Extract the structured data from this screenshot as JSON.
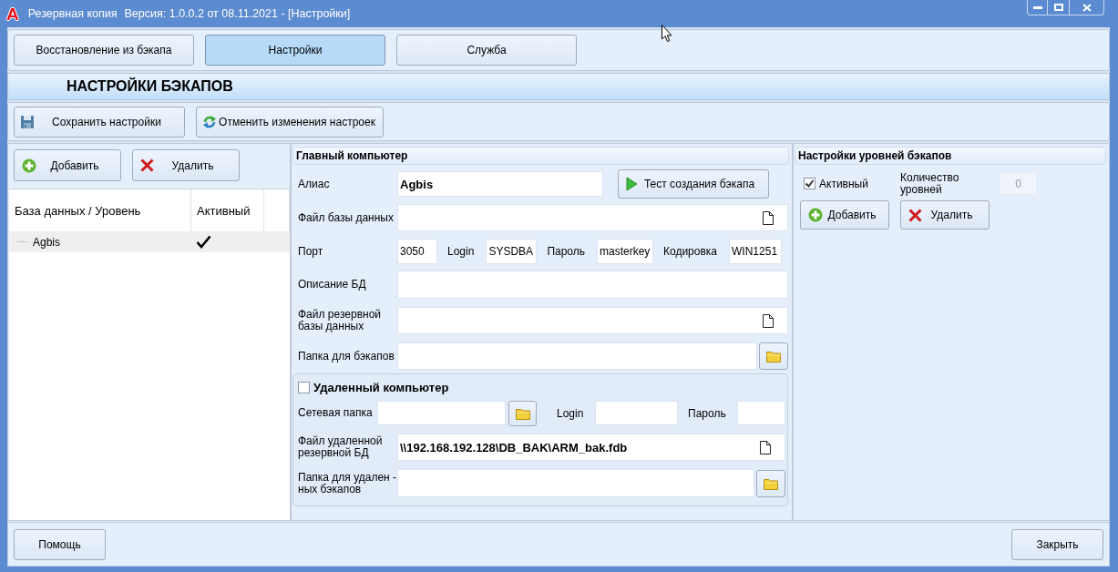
{
  "window": {
    "logo": "A",
    "app_name": "Резервная копия",
    "version": "Версия: 1.0.0.2 от 08.11.2021 - [Настройки]"
  },
  "tabs": [
    {
      "label": "Восстановление из бэкапа",
      "selected": false
    },
    {
      "label": "Настройки",
      "selected": true
    },
    {
      "label": "Служба",
      "selected": false
    }
  ],
  "section_title": "НАСТРОЙКИ БЭКАПОВ",
  "toolbar": [
    {
      "label": "Сохранить настройки",
      "kind": "save"
    },
    {
      "label": "Отменить изменения настроек",
      "kind": "revert"
    }
  ],
  "databases": {
    "buttons": [
      {
        "label": "Добавить",
        "kind": "add"
      },
      {
        "label": "Удалить",
        "kind": "delete"
      }
    ],
    "columns": [
      "База данных / Уровень",
      "Активный"
    ],
    "rows": [
      {
        "name": "Agbis",
        "active": true,
        "selected": true
      }
    ]
  },
  "main_computer": {
    "title": "Главный компьютер",
    "alias": {
      "label": "Алиас",
      "value": "Agbis"
    },
    "test_button": "Тест создания бэкапа",
    "db_file": {
      "label": "Файл базы данных"
    },
    "connection": [
      {
        "label": "Порт",
        "value": "3050"
      },
      {
        "label": "Login",
        "value": "SYSDBA"
      },
      {
        "label": "Пароль",
        "value": "masterkey"
      },
      {
        "label": "Кодировка",
        "value": "WIN1251"
      }
    ],
    "description": {
      "label": "Описание БД"
    },
    "backup_file": {
      "label": "Файл резервной\nбазы данных"
    },
    "backup_folder": {
      "label": "Папка для бэкапов"
    }
  },
  "remote_computer": {
    "title": "Удаленный компьютер",
    "enabled": false,
    "network_folder": {
      "label": "Сетевая папка"
    },
    "login": {
      "label": "Login"
    },
    "password": {
      "label": "Пароль"
    },
    "remote_file": {
      "label": "Файл удаленной\nрезервной БД",
      "value": "\\\\192.168.192.128\\DB_BAK\\ARM_bak.fdb"
    },
    "remote_folder": {
      "label": "Папка для удален -\nных бэкапов"
    }
  },
  "levels": {
    "title": "Настройки уровней бэкапов",
    "active": {
      "label": "Активный",
      "checked": true
    },
    "count": {
      "label": "Количество\nуровней",
      "value": "0",
      "disabled": true
    },
    "buttons": [
      {
        "label": "Добавить",
        "kind": "add"
      },
      {
        "label": "Удалить",
        "kind": "delete"
      }
    ]
  },
  "footer": [
    {
      "label": "Помощь"
    },
    {
      "label": "Закрыть"
    }
  ]
}
